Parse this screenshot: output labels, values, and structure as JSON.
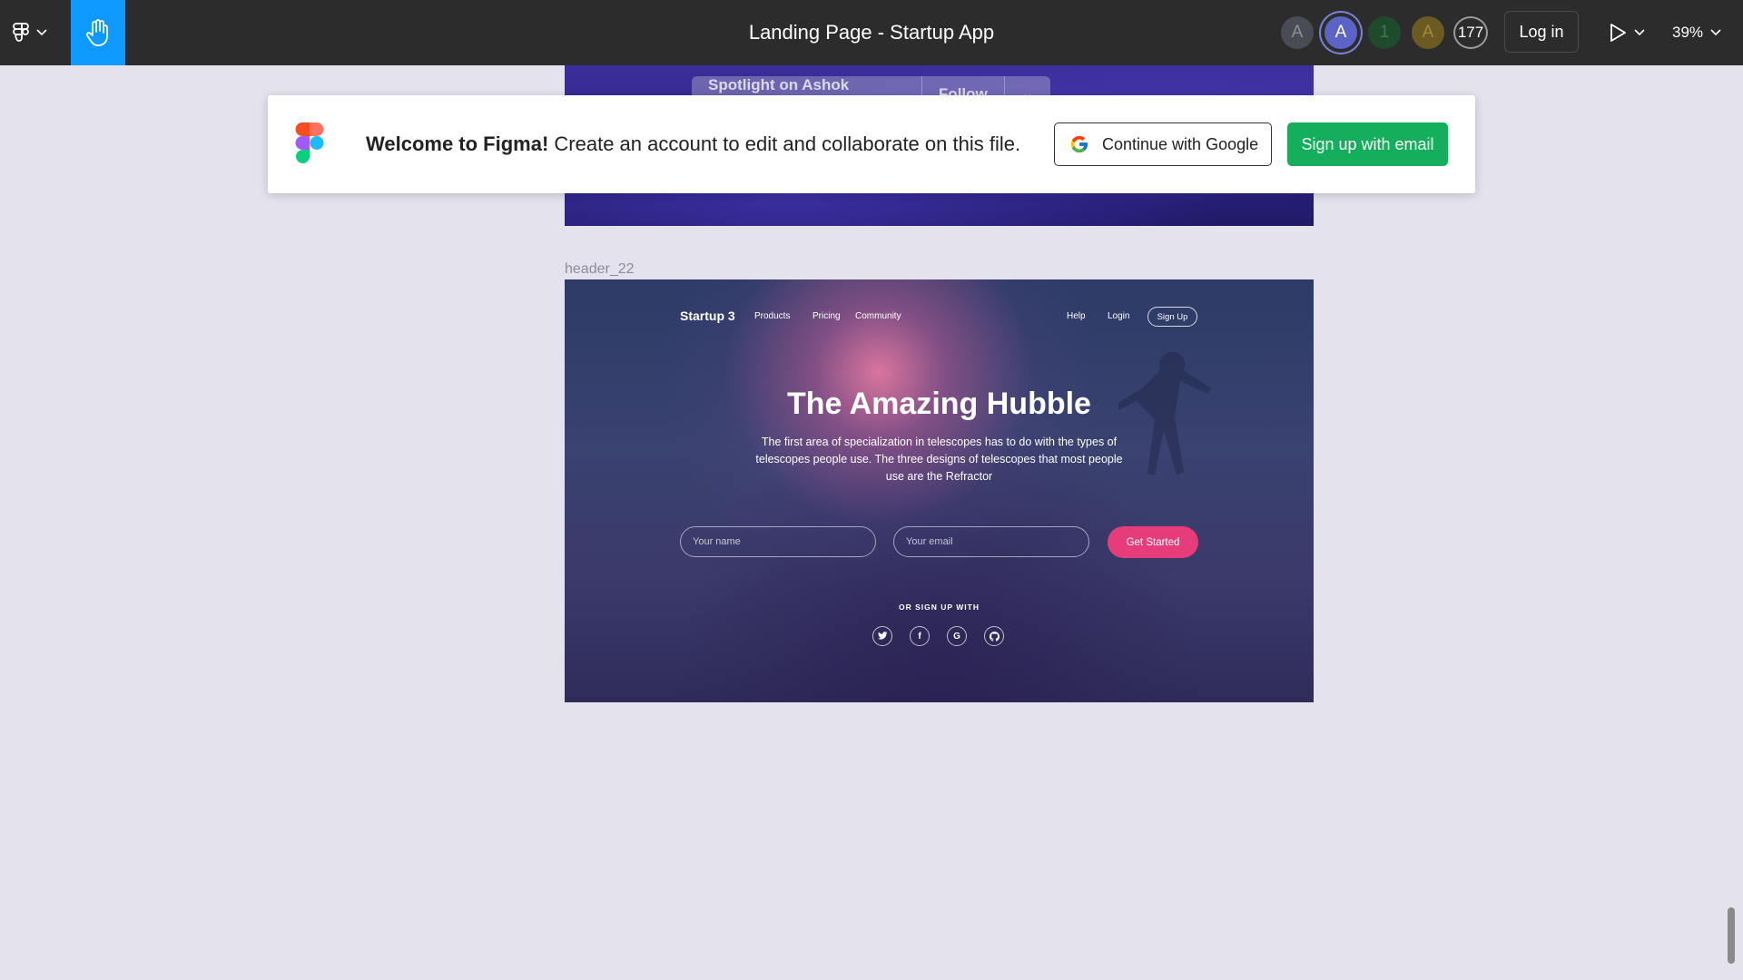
{
  "toolbar": {
    "file_title": "Landing Page - Startup App",
    "avatars": [
      "A",
      "A",
      "1",
      "A"
    ],
    "viewer_count": "177",
    "login_label": "Log in",
    "zoom": "39%"
  },
  "banner": {
    "welcome_bold": "Welcome to Figma!",
    "welcome_text": " Create an account to edit and collaborate on this file.",
    "google_label": "Continue with Google",
    "email_label": "Sign up with email"
  },
  "frame_top": {
    "spotlight_text": "Spotlight on Ashok Tatikonda",
    "follow_label": "Follow"
  },
  "frame_hero": {
    "label": "header_22",
    "brand": "Startup 3",
    "nav": [
      "Products",
      "Pricing",
      "Community"
    ],
    "nav_right": [
      "Help",
      "Login"
    ],
    "signup_label": "Sign Up",
    "title": "The Amazing Hubble",
    "description": "The first area of specialization in telescopes has to do with the types of telescopes people use. The three designs of telescopes that most people use are the Refractor",
    "name_placeholder": "Your name",
    "email_placeholder": "Your email",
    "cta_label": "Get Started",
    "or_text": "OR SIGN UP WITH",
    "social_icons": [
      "twitter-icon",
      "facebook-icon",
      "google-icon",
      "github-icon"
    ]
  },
  "colors": {
    "toolbar_bg": "#2c2c2c",
    "hand_tool_active": "#0d99ff",
    "canvas_bg": "#e4e2ec",
    "email_button": "#14ae5c",
    "cta_pink": "#e63d7a"
  }
}
